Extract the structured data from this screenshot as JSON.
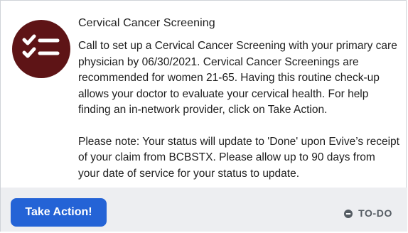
{
  "card": {
    "title": "Cervical Cancer Screening",
    "icon": "checklist-icon",
    "body_paragraph_1": "Call to set up a Cervical Cancer Screening with your primary care physician by 06/30/2021. Cervical Cancer Screenings are recommended for women 21-65. Having this routine check-up allows your doctor to evaluate your cervical health. For help finding an in-network provider, click on Take Action.",
    "body_paragraph_2": "Please note: Your status will update to 'Done' upon Evive’s receipt of your claim from BCBSTX. Please allow up to 90 days from your date of service for your status to update."
  },
  "footer": {
    "action_label": "Take Action!",
    "status_label": "TO-DO",
    "status_icon": "minus-circle-icon"
  },
  "colors": {
    "icon_background": "#5e1416",
    "button": "#2463d6",
    "footer_background": "#edeef1",
    "status_text": "#555c63"
  }
}
